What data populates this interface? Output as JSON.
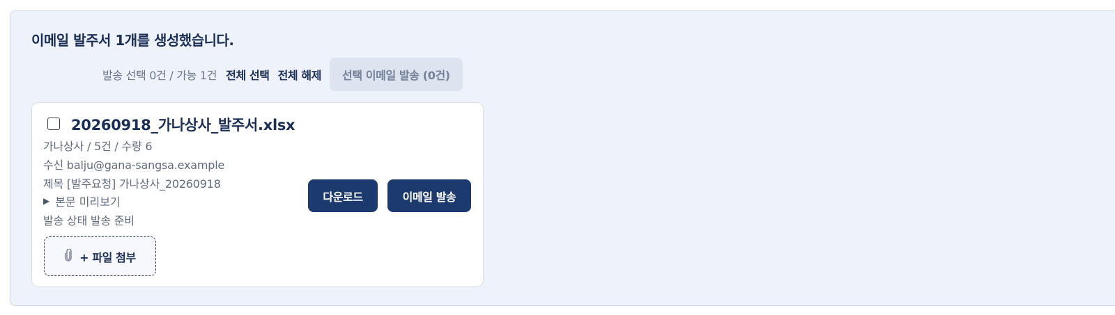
{
  "result": {
    "headline": "이메일 발주서 1개를 생성했습니다."
  },
  "toolbar": {
    "counter": "발송 선택 0건 / 가능 1건",
    "select_all": "전체 선택",
    "deselect_all": "전체 해제",
    "send_selected": "선택 이메일 발송 (0건)"
  },
  "card": {
    "checked": false,
    "file_name": "20260918_가나상사_발주서.xlsx",
    "summary": "가나상사 / 5건 / 수량 6",
    "recipient": "수신 balju@gana-sangsa.example",
    "subject": "제목 [발주요청] 가나상사_20260918",
    "preview_toggle": "본문 미리보기",
    "status": "발송 상태 발송 준비",
    "download_button": "다운로드",
    "email_button": "이메일 발송",
    "attach_button": "+ 파일 첨부",
    "attach_icon": "paperclip-icon",
    "preview_icon": "triangle-right-icon"
  },
  "colors": {
    "panel_bg": "#eef2fb",
    "primary": "#1d3a6e",
    "heading": "#1b2f56",
    "muted": "#5f6b7e",
    "disabled_bg": "#dde3ef"
  }
}
